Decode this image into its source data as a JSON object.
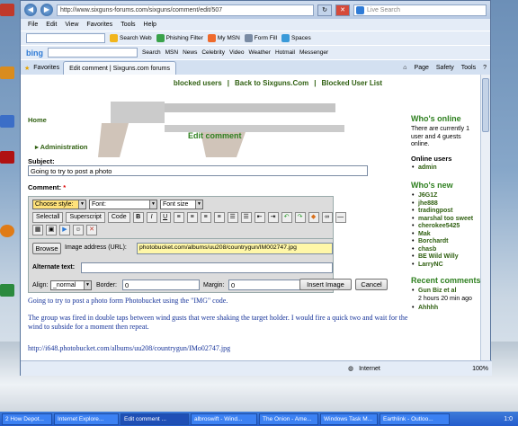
{
  "browser": {
    "url": "http://www.sixguns-forums.com/sixguns/comment/edit/507",
    "live_search_placeholder": "Live Search",
    "menu": [
      "File",
      "Edit",
      "View",
      "Favorites",
      "Tools",
      "Help"
    ],
    "toolbar1": [
      "Search Web",
      "Phishing Filter",
      "My MSN",
      "Form Fill",
      "Spaces"
    ],
    "toolbar2": [
      "Search",
      "MSN",
      "News",
      "Celebrity",
      "Video",
      "Weather",
      "Hotmail",
      "Messenger"
    ],
    "bing_label": "bing",
    "favorites_label": "Favorites",
    "tab_title": "Edit comment | Sixguns.com forums",
    "commands": [
      "Page",
      "Safety",
      "Tools"
    ],
    "status_zone": "Internet",
    "zoom": "100%"
  },
  "page": {
    "top_links": [
      "blocked users",
      "|",
      "Back to Sixguns.Com",
      "|",
      "Blocked User List"
    ],
    "home_link": "Home",
    "administration_link": "Administration",
    "title": "Edit comment",
    "subject_label": "Subject:",
    "subject_value": "Going to try to post a photo",
    "comment_label": "Comment:",
    "required_mark": "*",
    "editor": {
      "choose_style": "Choose style:",
      "font": "Font:",
      "font_size": "Font size",
      "buttons": [
        "Selectall",
        "Superscript",
        "Code",
        "B",
        "I",
        "U"
      ],
      "browse_label": "Browse",
      "image_address_label": "Image address (URL):",
      "image_address_value": "photobucket.com/albums/uu208/countrygun/IM002747.jpg",
      "alternate_text_label": "Alternate text:",
      "align_label": "Align:",
      "align_value": "_normal",
      "border_label": "Border:",
      "border_value": "0",
      "margin_label": "Margin:",
      "margin_value": "0",
      "insert_image": "Insert Image",
      "cancel": "Cancel"
    },
    "post_body": [
      "Going to try to post a photo form Photobucket using the \"IMG\" code.",
      "The group was fired in double taps between wind gusts that were  shaking the target holder. I would fire a quick two and wait for the wind to subside for a moment then repeat.",
      "http://i648.photobucket.com/albums/uu208/countrygun/IMo02747.jpg"
    ]
  },
  "sidebar": {
    "whos_online_title": "Who's online",
    "whos_online_text": "There are currently 1 user and 4 guests online.",
    "online_users_title": "Online users",
    "online_users": [
      "admin"
    ],
    "whos_new_title": "Who's new",
    "new_users": [
      "J6G1Z",
      "jhe888",
      "tradingpost",
      "marshal too sweet",
      "cherokee5425",
      "Mak",
      "Borchardt",
      "chasb",
      "BE Wild Willy",
      "LarryNC"
    ],
    "recent_comments_title": "Recent comments",
    "recent_comments": [
      {
        "title": "Gun Biz et al",
        "age": "2 hours 20 min ago"
      },
      {
        "title": "Ahhhh",
        "age": ""
      }
    ]
  },
  "taskbar": {
    "items": [
      "2 How Depot...",
      "Internet Explore...",
      "Edit comment ...",
      "albroswift - Wind...",
      "The Onion - Ame...",
      "Windows Task M...",
      "Earthlink - Outloo..."
    ],
    "clock": "1:0"
  },
  "desktop_icons": [
    "Acronis True Image Home",
    "Acronis True Image",
    "Acronis True Image Hor",
    "SpeedFan",
    "Windows Explorer",
    "Adobe Reader",
    "Mozilla Firefox"
  ],
  "colors": {
    "link_green": "#2f5f10",
    "title_green": "#2f8020",
    "post_blue": "#18359a"
  }
}
